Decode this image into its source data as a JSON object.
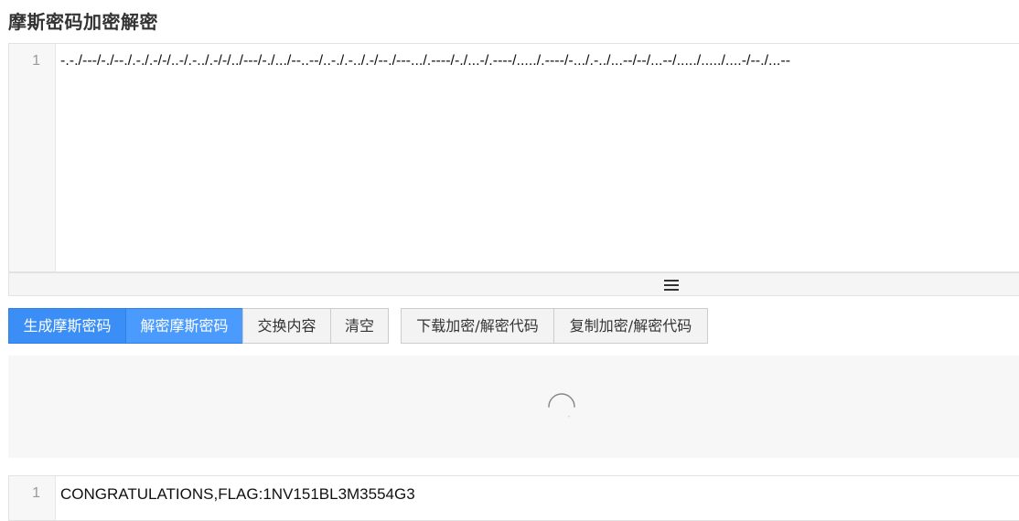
{
  "page": {
    "title": "摩斯密码加密解密"
  },
  "input_editor": {
    "line_number": "1",
    "content": "-.-./---/-./--./.-./.-/-/..-/.-../.-/-/../---/-./.../--..--/..-./.-../.-/--./---.../.----/-./...-/.----/...../.----/-.../.-../...--/--/...--/...../...../....-/--./...--"
  },
  "resize_bar": {
    "icon": "hamburger-icon"
  },
  "toolbar": {
    "encode_label": "生成摩斯密码",
    "decode_label": "解密摩斯密码",
    "swap_label": "交换内容",
    "clear_label": "清空",
    "download_label": "下载加密/解密代码",
    "copy_label": "复制加密/解密代码"
  },
  "loading": {
    "icon": "spinner-icon"
  },
  "output_editor": {
    "line_number": "1",
    "content": "CONGRATULATIONS,FLAG:1NV151BL3M3554G3"
  },
  "colors": {
    "primary": "#3a8ef6",
    "active": "#4b9bff",
    "panel_bg": "#f7f7f7"
  }
}
